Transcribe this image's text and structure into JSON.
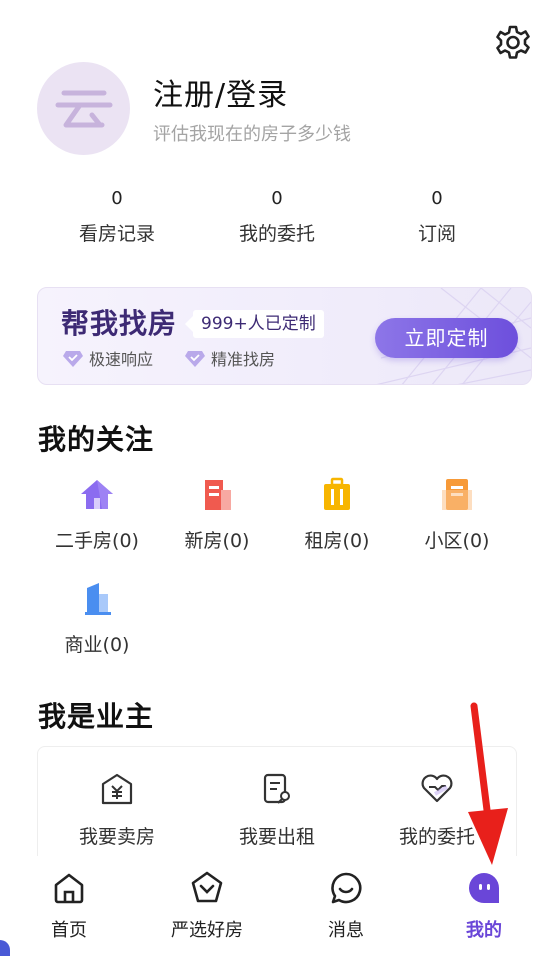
{
  "header": {
    "settings_icon": "gear-icon",
    "avatar_icon": "yun-logo-icon",
    "login_title": "注册/登录",
    "login_subtitle": "评估我现在的房子多少钱"
  },
  "stats": [
    {
      "value": "0",
      "label": "看房记录"
    },
    {
      "value": "0",
      "label": "我的委托"
    },
    {
      "value": "0",
      "label": "订阅"
    }
  ],
  "banner": {
    "title": "帮我找房",
    "tag": "999+人已定制",
    "features": [
      "极速响应",
      "精准找房"
    ],
    "button_label": "立即定制",
    "accent": "#6d4fdc"
  },
  "favorites": {
    "title": "我的关注",
    "items": [
      {
        "label": "二手房(0)",
        "icon": "house-icon",
        "color": "#8b6cf0"
      },
      {
        "label": "新房(0)",
        "icon": "building-icon",
        "color": "#f05a4f"
      },
      {
        "label": "租房(0)",
        "icon": "suitcase-icon",
        "color": "#f7b500"
      },
      {
        "label": "小区(0)",
        "icon": "community-icon",
        "color": "#f79a38"
      },
      {
        "label": "商业(0)",
        "icon": "office-tower-icon",
        "color": "#4a8ef0"
      }
    ]
  },
  "owner": {
    "title": "我是业主",
    "items": [
      {
        "label": "我要卖房",
        "icon": "sell-house-icon"
      },
      {
        "label": "我要出租",
        "icon": "rent-document-icon"
      },
      {
        "label": "我的委托",
        "icon": "heart-handshake-icon"
      }
    ]
  },
  "tabbar": {
    "items": [
      {
        "label": "首页",
        "icon": "home-icon",
        "active": false
      },
      {
        "label": "严选好房",
        "icon": "shield-check-icon",
        "active": false
      },
      {
        "label": "消息",
        "icon": "chat-bubble-icon",
        "active": false
      },
      {
        "label": "我的",
        "icon": "profile-face-icon",
        "active": true
      }
    ],
    "active_color": "#6a46d8"
  },
  "annotation": {
    "arrow_color": "#e8201b"
  }
}
